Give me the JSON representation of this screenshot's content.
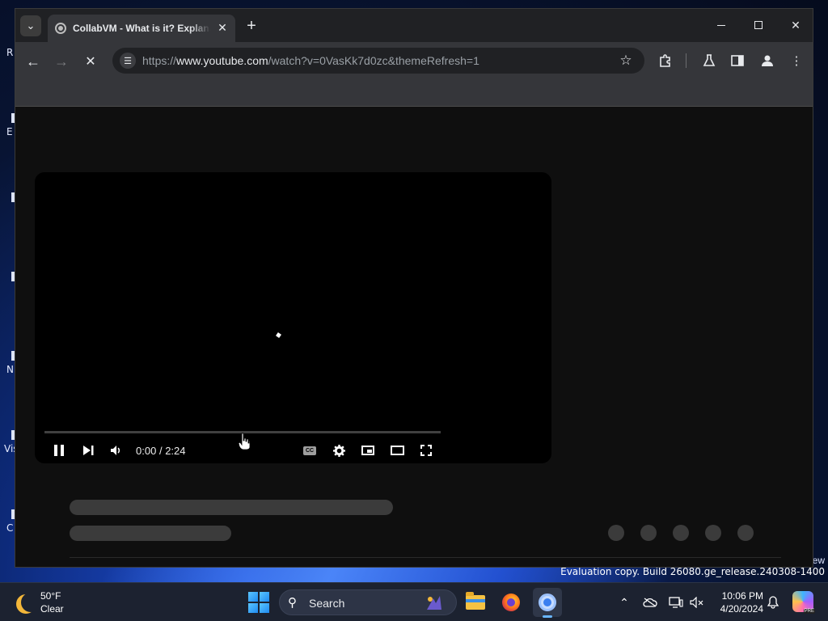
{
  "browser": {
    "tab_title": "CollabVM - What is it? Explanation",
    "url_prefix": "https://",
    "url_host": "www.youtube.com",
    "url_path": "/watch?v=0VasKk7d0zc&themeRefresh=1",
    "icons": {
      "tab_search": "chevron-down-icon",
      "tab_close": "close-icon",
      "new_tab": "plus-icon",
      "back": "back-arrow-icon",
      "forward": "forward-arrow-icon",
      "stop": "stop-icon",
      "site_info": "tune-icon",
      "bookmark": "star-icon",
      "extensions": "puzzle-icon",
      "labs": "flask-icon",
      "side_panel": "side-panel-icon",
      "profile": "profile-icon",
      "menu": "kebab-menu-icon"
    }
  },
  "player": {
    "time_current": "0:00",
    "time_separator": "/",
    "time_total": "2:24",
    "progress": 0.0
  },
  "desktop": {
    "icon_labels": [
      "R",
      "E",
      "N",
      "Vis",
      "C"
    ],
    "watermark_top": "ew",
    "watermark": "Evaluation copy. Build 26080.ge_release.240308-1400"
  },
  "taskbar": {
    "weather_temp": "50°F",
    "weather_condition": "Clear",
    "search_placeholder": "Search",
    "time": "10:06 PM",
    "date": "4/20/2024",
    "apps": [
      "start-icon",
      "file-explorer-icon",
      "firefox-icon",
      "chrome-icon"
    ],
    "tray": [
      "chevron-up-icon",
      "onedrive-icon",
      "display-icon",
      "volume-muted-icon",
      "bell-icon",
      "copilot-icon"
    ]
  },
  "colors": {
    "youtube_bg": "#0f0f0f",
    "toolbar": "#35363a",
    "tabstrip": "#202124",
    "skeleton": "#3b3b3b",
    "taskbar": "#1c2230"
  }
}
